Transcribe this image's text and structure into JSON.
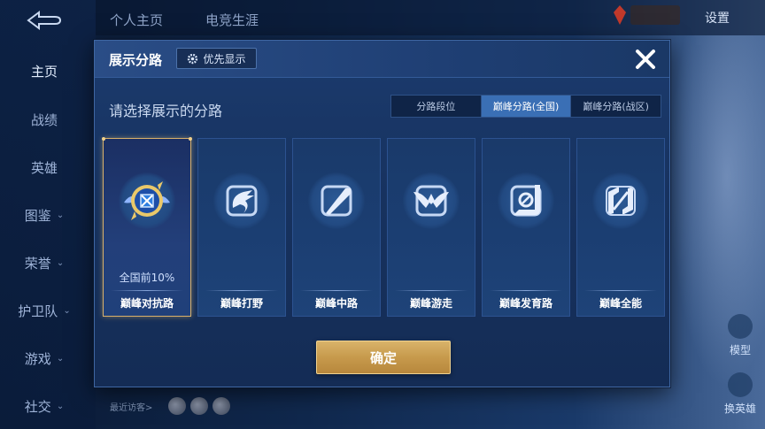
{
  "background": {
    "top_tabs": [
      "个人主页",
      "电竞生涯"
    ],
    "settings_label": "设置",
    "sidebar_items": [
      {
        "label": "主页",
        "has_chevron": false
      },
      {
        "label": "战绩",
        "has_chevron": false
      },
      {
        "label": "英雄",
        "has_chevron": false
      },
      {
        "label": "图鉴",
        "has_chevron": true
      },
      {
        "label": "荣誉",
        "has_chevron": true
      },
      {
        "label": "护卫队",
        "has_chevron": true
      },
      {
        "label": "游戏",
        "has_chevron": true
      },
      {
        "label": "社交",
        "has_chevron": true
      }
    ],
    "recent_visitors_label": "最近访客>",
    "right_buttons": [
      {
        "label": "模型",
        "icon": "figure-icon"
      },
      {
        "label": "换英雄",
        "icon": "swap-hero-icon"
      }
    ]
  },
  "modal": {
    "title": "展示分路",
    "priority_label": "优先显示",
    "prompt": "请选择展示的分路",
    "filter_tabs": [
      {
        "label": "分路段位",
        "active": false
      },
      {
        "label": "巅峰分路(全国)",
        "active": true
      },
      {
        "label": "巅峰分路(战区)",
        "active": false
      }
    ],
    "lanes": [
      {
        "name": "巅峰对抗路",
        "rank": "全国前10%",
        "selected": true,
        "icon": "clash-lane-emblem-icon"
      },
      {
        "name": "巅峰打野",
        "rank": "",
        "selected": false,
        "icon": "dragon-icon"
      },
      {
        "name": "巅峰中路",
        "rank": "",
        "selected": false,
        "icon": "staff-icon"
      },
      {
        "name": "巅峰游走",
        "rank": "",
        "selected": false,
        "icon": "wings-icon"
      },
      {
        "name": "巅峰发育路",
        "rank": "",
        "selected": false,
        "icon": "target-icon"
      },
      {
        "name": "巅峰全能",
        "rank": "",
        "selected": false,
        "icon": "all-round-icon"
      }
    ],
    "confirm_label": "确定"
  },
  "colors": {
    "accent_blue": "#3a6fb5",
    "gold": "#d8b06a",
    "modal_bg": "#17325f"
  }
}
